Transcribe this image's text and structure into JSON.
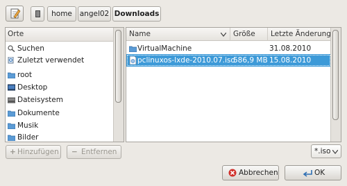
{
  "toolbar": {
    "edit_icon": "edit-pencil-icon",
    "breadcrumbs": [
      "home",
      "angel02",
      "Downloads"
    ]
  },
  "places": {
    "header": "Orte",
    "items": [
      {
        "label": "Suchen",
        "icon": "search-icon"
      },
      {
        "label": "Zuletzt verwendet",
        "icon": "recent-icon"
      },
      {
        "label": "root",
        "icon": "folder-icon"
      },
      {
        "label": "Desktop",
        "icon": "desktop-icon"
      },
      {
        "label": "Dateisystem",
        "icon": "drive-icon"
      },
      {
        "label": "Dokumente",
        "icon": "folder-icon"
      },
      {
        "label": "Musik",
        "icon": "folder-icon"
      },
      {
        "label": "Bilder",
        "icon": "folder-icon"
      }
    ],
    "add_label": "Hinzufügen",
    "remove_label": "Entfernen"
  },
  "files": {
    "columns": {
      "name": "Name",
      "size": "Größe",
      "modified": "Letzte Änderung"
    },
    "rows": [
      {
        "name": "VirtualMachine",
        "size": "",
        "modified": "31.08.2010",
        "icon": "folder-icon",
        "selected": false
      },
      {
        "name": "pclinuxos-lxde-2010.07.iso",
        "size": "586,9 MB",
        "modified": "15.08.2010",
        "icon": "iso-file-icon",
        "selected": true
      }
    ]
  },
  "filter": {
    "value": "*.iso"
  },
  "buttons": {
    "cancel": "Abbrechen",
    "ok": "OK"
  },
  "colors": {
    "selection": "#3d9ad8",
    "folder": "#5b9bd5"
  }
}
